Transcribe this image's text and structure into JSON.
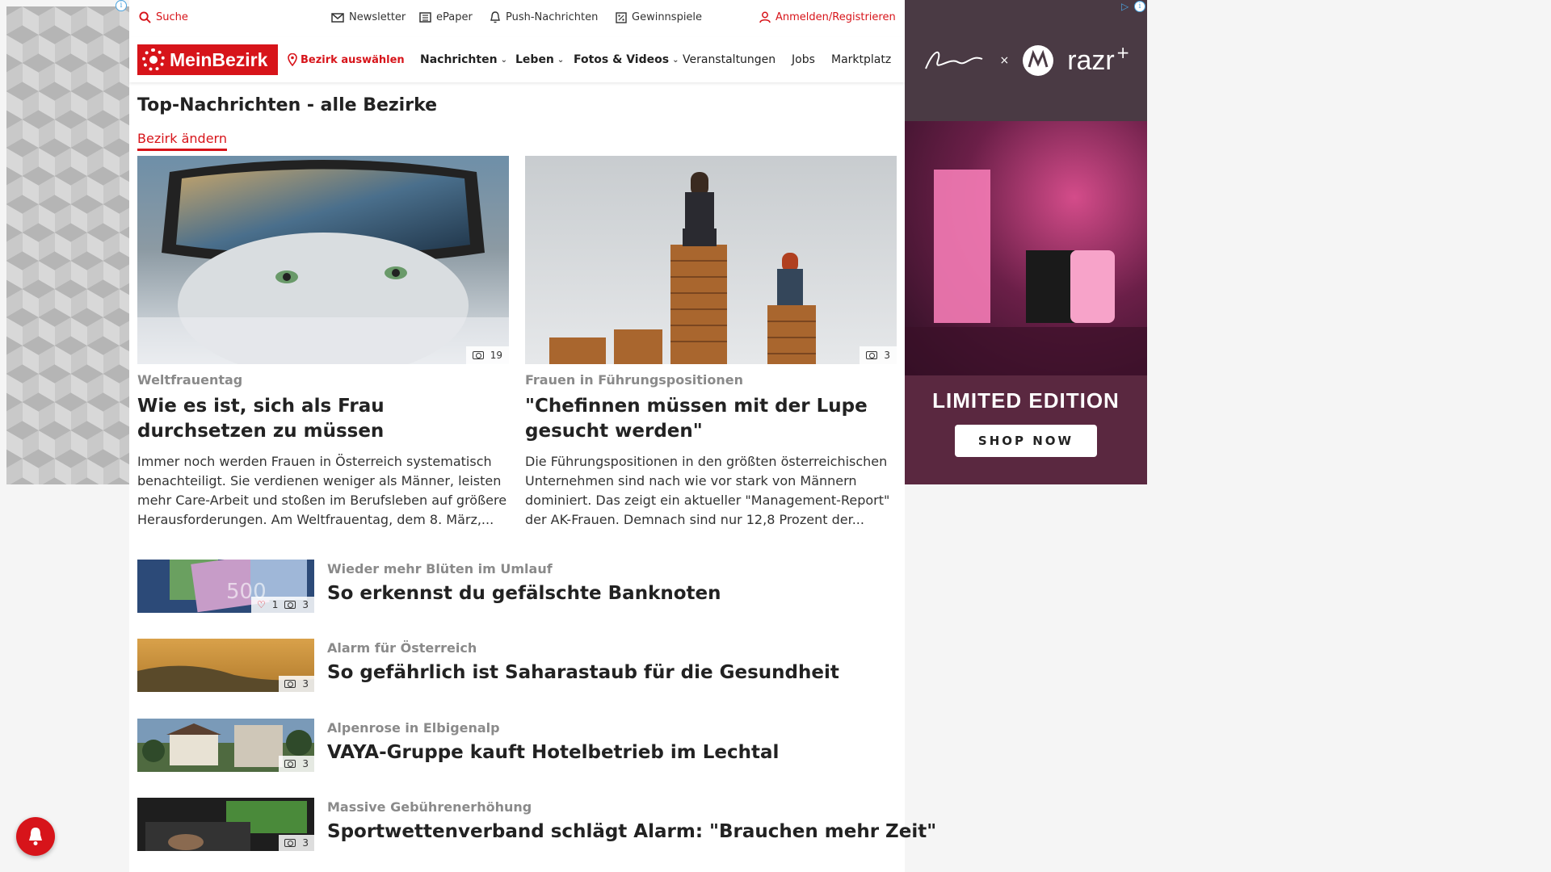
{
  "topbar": {
    "search": "Suche",
    "newsletter": "Newsletter",
    "epaper": "ePaper",
    "push": "Push-Nachrichten",
    "gewinnspiele": "Gewinnspiele",
    "login": "Anmelden/Registrieren"
  },
  "nav": {
    "logo": "MeinBezirk",
    "bezirk": "Bezirk auswählen",
    "items": [
      "Nachrichten",
      "Leben",
      "Fotos & Videos",
      "Veranstaltungen",
      "Jobs",
      "Marktplatz"
    ]
  },
  "section": {
    "title": "Top-Nachrichten - alle Bezirke",
    "change": "Bezirk ändern"
  },
  "cards": [
    {
      "kicker": "Weltfrauentag",
      "headline": "Wie es ist, sich als Frau durchsetzen zu müssen",
      "teaser": "Immer noch werden Frauen in Österreich systematisch benachteiligt. Sie verdienen weniger als Männer, leisten mehr Care-Arbeit und stoßen im Berufsleben auf größere Herausforderungen. Am Weltfrauentag, dem 8. März,...",
      "photos": "19"
    },
    {
      "kicker": "Frauen in Führungspositionen",
      "headline": "\"Chefinnen müssen mit der Lupe gesucht werden\"",
      "teaser": "Die Führungspositionen in den größten österreichischen Unternehmen sind nach wie vor stark von Männern dominiert. Das zeigt ein aktueller \"Management-Report\" der AK-Frauen. Demnach sind nur 12,8 Prozent der...",
      "photos": "3"
    }
  ],
  "list": [
    {
      "kicker": "Wieder mehr Blüten im Umlauf",
      "headline": "So erkennst du gefälschte Banknoten",
      "likes": "1",
      "photos": "3"
    },
    {
      "kicker": "Alarm für Österreich",
      "headline": "So gefährlich ist Saharastaub für die Gesundheit",
      "photos": "3"
    },
    {
      "kicker": "Alpenrose in Elbigenalp",
      "headline": "VAYA-Gruppe kauft Hotelbetrieb im Lechtal",
      "photos": "3"
    },
    {
      "kicker": "Massive Gebührenerhöhung",
      "headline": "Sportwettenverband schlägt Alarm: \"Brauchen mehr Zeit\"",
      "photos": "3"
    }
  ],
  "ad": {
    "brand": "razr",
    "cta": "SHOP NOW",
    "tagline": "LIMITED EDITION"
  },
  "colors": {
    "brand_red": "#d7141a",
    "kicker_gray": "#8a8a8a"
  }
}
